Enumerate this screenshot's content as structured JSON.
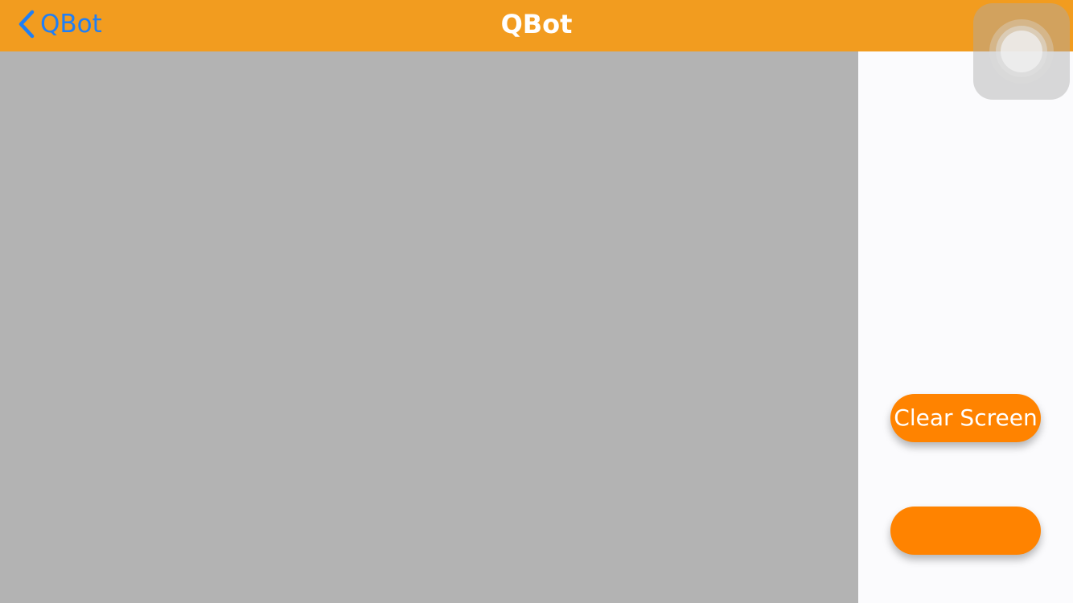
{
  "navbar": {
    "back_label": "QBot",
    "title": "QBot"
  },
  "buttons": {
    "clear_screen_label": "Clear Screen",
    "second_label": ""
  },
  "colors": {
    "navbar_bg": "#f29c1f",
    "back_tint": "#1f7ff6",
    "button_bg": "#ff8300",
    "canvas_bg": "#b3b3b3",
    "panel_bg": "#fbfbfd"
  },
  "icons": {
    "back": "chevron-left-icon",
    "assistive_touch": "assistive-touch-icon"
  }
}
